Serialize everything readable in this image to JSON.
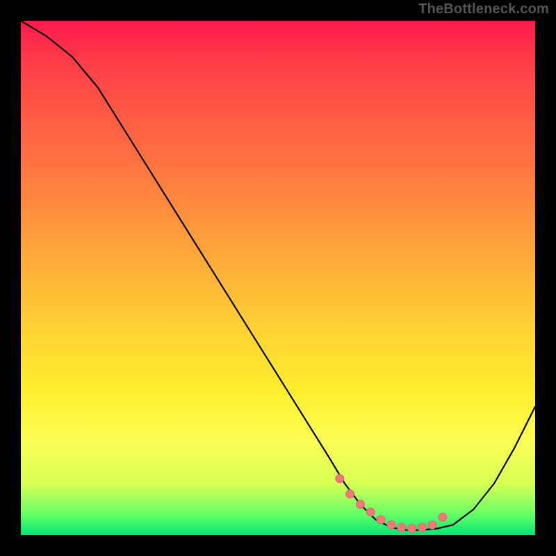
{
  "watermark": "TheBottleneck.com",
  "colors": {
    "background": "#000000",
    "curve_stroke": "#000000",
    "marker_fill": "#ee7a78",
    "marker_stroke": "#e86765"
  },
  "chart_data": {
    "type": "line",
    "title": "",
    "xlabel": "",
    "ylabel": "",
    "xlim": [
      0,
      100
    ],
    "ylim": [
      0,
      100
    ],
    "annotations": [
      "TheBottleneck.com"
    ],
    "series": [
      {
        "name": "bottleneck-curve",
        "x": [
          0,
          5,
          10,
          15,
          20,
          25,
          30,
          35,
          40,
          45,
          50,
          55,
          60,
          63,
          66,
          69,
          72,
          75,
          78,
          81,
          84,
          88,
          92,
          96,
          100
        ],
        "y": [
          100,
          97,
          93,
          87,
          79,
          71,
          63,
          55,
          47,
          39,
          31,
          23,
          15,
          10,
          6,
          3,
          1.5,
          1,
          1,
          1.3,
          2,
          5,
          10,
          17,
          25
        ]
      }
    ],
    "markers": {
      "name": "highlight-dots",
      "x": [
        62,
        64,
        66,
        68,
        70,
        72,
        74,
        76,
        78,
        80,
        82
      ],
      "y": [
        11,
        8,
        6,
        4.5,
        3,
        2,
        1.5,
        1.3,
        1.5,
        2,
        3.5
      ]
    }
  }
}
